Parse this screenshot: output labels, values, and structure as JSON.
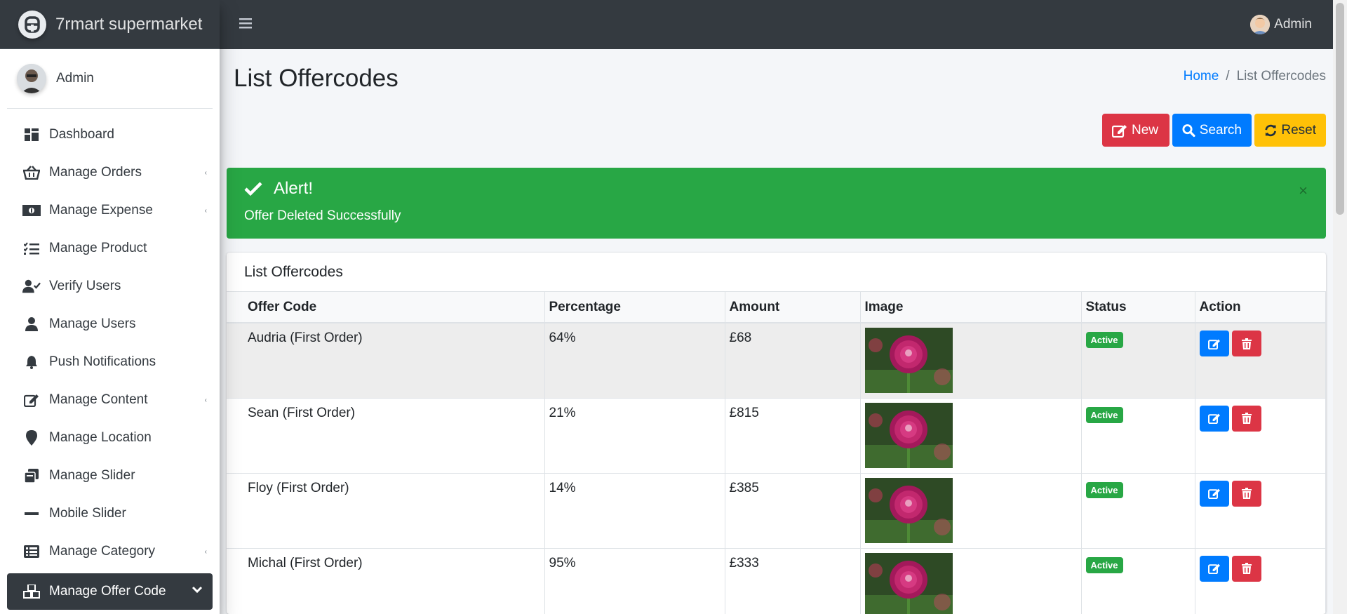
{
  "app": {
    "brand": "7rmart supermarket"
  },
  "sidebar": {
    "user_name": "Admin",
    "items": [
      {
        "label": "Dashboard",
        "icon": "dashboard-icon",
        "has_caret": false
      },
      {
        "label": "Manage Orders",
        "icon": "basket-icon",
        "has_caret": true
      },
      {
        "label": "Manage Expense",
        "icon": "money-icon",
        "has_caret": true
      },
      {
        "label": "Manage Product",
        "icon": "tasks-icon",
        "has_caret": false
      },
      {
        "label": "Verify Users",
        "icon": "user-check-icon",
        "has_caret": false
      },
      {
        "label": "Manage Users",
        "icon": "user-icon",
        "has_caret": false
      },
      {
        "label": "Push Notifications",
        "icon": "bell-icon",
        "has_caret": false
      },
      {
        "label": "Manage Content",
        "icon": "edit-icon",
        "has_caret": true
      },
      {
        "label": "Manage Location",
        "icon": "map-marker-icon",
        "has_caret": false
      },
      {
        "label": "Manage Slider",
        "icon": "clone-icon",
        "has_caret": false
      },
      {
        "label": "Mobile Slider",
        "icon": "minus-icon",
        "has_caret": false
      },
      {
        "label": "Manage Category",
        "icon": "list-icon",
        "has_caret": true
      },
      {
        "label": "Manage Offer Code",
        "icon": "cubes-icon",
        "has_caret": true,
        "active": true
      }
    ]
  },
  "topbar": {
    "user_name": "Admin"
  },
  "page": {
    "title": "List Offercodes",
    "breadcrumb": {
      "home": "Home",
      "separator": "/",
      "current": "List Offercodes"
    }
  },
  "toolbar": {
    "new_label": "New",
    "search_label": "Search",
    "reset_label": "Reset"
  },
  "alert": {
    "title": "Alert!",
    "message": "Offer Deleted Successfully",
    "close": "×"
  },
  "table": {
    "card_title": "List Offercodes",
    "columns": [
      "Offer Code",
      "Percentage",
      "Amount",
      "Image",
      "Status",
      "Action"
    ],
    "rows": [
      {
        "code": "Audria (First Order)",
        "percentage": "64%",
        "amount": "£68",
        "status": "Active"
      },
      {
        "code": "Sean (First Order)",
        "percentage": "21%",
        "amount": "£815",
        "status": "Active"
      },
      {
        "code": "Floy (First Order)",
        "percentage": "14%",
        "amount": "£385",
        "status": "Active"
      },
      {
        "code": "Michal (First Order)",
        "percentage": "95%",
        "amount": "£333",
        "status": "Active"
      }
    ]
  },
  "colors": {
    "dark": "#343a40",
    "primary": "#007bff",
    "danger": "#dc3545",
    "warning": "#ffc107",
    "success": "#28a745"
  }
}
